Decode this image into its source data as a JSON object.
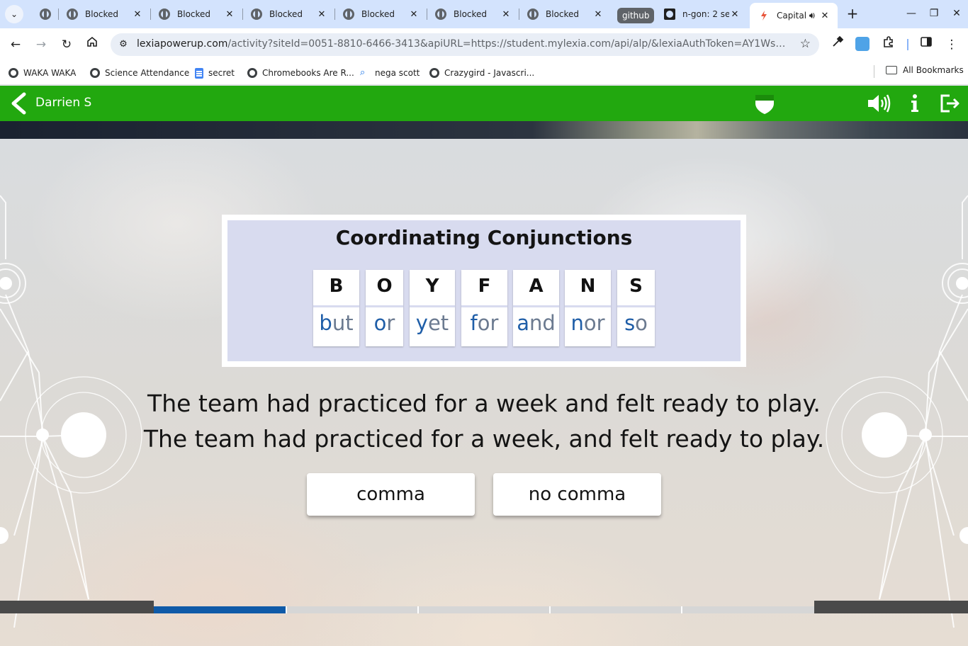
{
  "browser": {
    "tabs": [
      {
        "title": "Blocked",
        "active": false
      },
      {
        "title": "Blocked",
        "active": false
      },
      {
        "title": "Blocked",
        "active": false
      },
      {
        "title": "Blocked",
        "active": false
      },
      {
        "title": "Blocked",
        "active": false
      },
      {
        "title": "Blocked",
        "active": false
      },
      {
        "title": "n-gon: 2 se",
        "active": false
      },
      {
        "title": "Capital",
        "active": true
      }
    ],
    "tab_group_label": "github",
    "url_domain": "lexiapowerup.com",
    "url_path": "/activity?siteId=0051-8810-6466-3413&apiURL=https://student.mylexia.com/api/alp/&lexiaAuthToken=AY1WsMylNHbOASE9Gz…",
    "bookmarks": [
      {
        "label": "WAKA WAKA",
        "icon": "globe-icon"
      },
      {
        "label": "Science Attendance",
        "icon": "globe-icon"
      },
      {
        "label": "secret",
        "icon": "docs-icon"
      },
      {
        "label": "Chromebooks Are R...",
        "icon": "globe-icon"
      },
      {
        "label": "nega scott",
        "icon": "search-icon"
      },
      {
        "label": "Crazygird - Javascri...",
        "icon": "globe-icon"
      }
    ],
    "all_bookmarks_label": "All Bookmarks"
  },
  "app": {
    "student_name": "Darrien S",
    "brand_color": "#22a80f"
  },
  "lesson": {
    "card_title": "Coordinating Conjunctions",
    "tiles": [
      {
        "letter": "B",
        "first": "b",
        "rest": "ut"
      },
      {
        "letter": "O",
        "first": "o",
        "rest": "r"
      },
      {
        "letter": "Y",
        "first": "y",
        "rest": "et"
      },
      {
        "letter": "F",
        "first": "f",
        "rest": "or"
      },
      {
        "letter": "A",
        "first": "a",
        "rest": "nd"
      },
      {
        "letter": "N",
        "first": "n",
        "rest": "or"
      },
      {
        "letter": "S",
        "first": "s",
        "rest": "o"
      }
    ],
    "sentence_1": "The team had practiced for a week and felt ready to play.",
    "sentence_2": "The team had practiced for a week, and felt ready to play.",
    "answer_a": "comma",
    "answer_b": "no comma",
    "progress": {
      "segments": 5,
      "completed": 1
    }
  }
}
